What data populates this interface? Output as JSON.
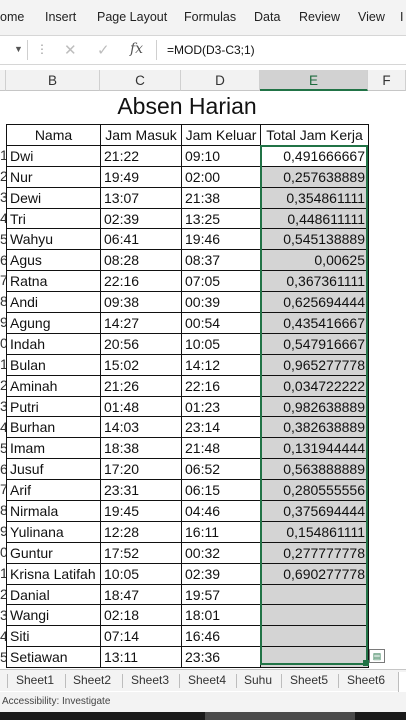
{
  "ribbon": {
    "tabs": [
      "ome",
      "Insert",
      "Page Layout",
      "Formulas",
      "Data",
      "Review",
      "View",
      "I"
    ]
  },
  "formula_bar": {
    "fx_label": "fx",
    "formula": "=MOD(D3-C3;1)"
  },
  "columns": [
    "B",
    "C",
    "D",
    "E",
    "F"
  ],
  "title": "Absen Harian",
  "table": {
    "headers": [
      "Nama",
      "Jam Masuk",
      "Jam Keluar",
      "Total Jam Kerja"
    ],
    "rows": [
      {
        "n": "1",
        "nama": "Dwi",
        "masuk": "21:22",
        "keluar": "09:10",
        "total": "0,491666667"
      },
      {
        "n": "2",
        "nama": "Nur",
        "masuk": "19:49",
        "keluar": "02:00",
        "total": "0,257638889"
      },
      {
        "n": "3",
        "nama": "Dewi",
        "masuk": "13:07",
        "keluar": "21:38",
        "total": "0,354861111"
      },
      {
        "n": "4",
        "nama": "Tri",
        "masuk": "02:39",
        "keluar": "13:25",
        "total": "0,448611111"
      },
      {
        "n": "5",
        "nama": "Wahyu",
        "masuk": "06:41",
        "keluar": "19:46",
        "total": "0,545138889"
      },
      {
        "n": "6",
        "nama": "Agus",
        "masuk": "08:28",
        "keluar": "08:37",
        "total": "0,00625"
      },
      {
        "n": "7",
        "nama": "Ratna",
        "masuk": "22:16",
        "keluar": "07:05",
        "total": "0,367361111"
      },
      {
        "n": "8",
        "nama": "Andi",
        "masuk": "09:38",
        "keluar": "00:39",
        "total": "0,625694444"
      },
      {
        "n": "9",
        "nama": "Agung",
        "masuk": "14:27",
        "keluar": "00:54",
        "total": "0,435416667"
      },
      {
        "n": "0",
        "nama": "Indah",
        "masuk": "20:56",
        "keluar": "10:05",
        "total": "0,547916667"
      },
      {
        "n": "1",
        "nama": "Bulan",
        "masuk": "15:02",
        "keluar": "14:12",
        "total": "0,965277778"
      },
      {
        "n": "2",
        "nama": "Aminah",
        "masuk": "21:26",
        "keluar": "22:16",
        "total": "0,034722222"
      },
      {
        "n": "3",
        "nama": "Putri",
        "masuk": "01:48",
        "keluar": "01:23",
        "total": "0,982638889"
      },
      {
        "n": "4",
        "nama": "Burhan",
        "masuk": "14:03",
        "keluar": "23:14",
        "total": "0,382638889"
      },
      {
        "n": "5",
        "nama": "Imam",
        "masuk": "18:38",
        "keluar": "21:48",
        "total": "0,131944444"
      },
      {
        "n": "6",
        "nama": "Jusuf",
        "masuk": "17:20",
        "keluar": "06:52",
        "total": "0,563888889"
      },
      {
        "n": "7",
        "nama": "Arif",
        "masuk": "23:31",
        "keluar": "06:15",
        "total": "0,280555556"
      },
      {
        "n": "8",
        "nama": "Nirmala",
        "masuk": "19:45",
        "keluar": "04:46",
        "total": "0,375694444"
      },
      {
        "n": "9",
        "nama": "Yulinana",
        "masuk": "12:28",
        "keluar": "16:11",
        "total": "0,154861111"
      },
      {
        "n": "0",
        "nama": "Guntur",
        "masuk": "17:52",
        "keluar": "00:32",
        "total": "0,277777778"
      },
      {
        "n": "1",
        "nama": "Krisna Latifah",
        "masuk": "10:05",
        "keluar": "02:39",
        "total": "0,690277778"
      },
      {
        "n": "2",
        "nama": "Danial",
        "masuk": "18:47",
        "keluar": "19:57",
        "total": ""
      },
      {
        "n": "3",
        "nama": "Wangi",
        "masuk": "02:18",
        "keluar": "18:01",
        "total": ""
      },
      {
        "n": "4",
        "nama": "Siti",
        "masuk": "07:14",
        "keluar": "16:46",
        "total": ""
      },
      {
        "n": "5",
        "nama": "Setiawan",
        "masuk": "13:11",
        "keluar": "23:36",
        "total": ""
      }
    ]
  },
  "sheets": [
    "Sheet1",
    "Sheet2",
    "Sheet3",
    "Sheet4",
    "Suhu",
    "Sheet5",
    "Sheet6"
  ],
  "status": "Accessibility: Investigate",
  "colors": {
    "accent": "#217346",
    "selected_fill": "#d4d4d4"
  }
}
